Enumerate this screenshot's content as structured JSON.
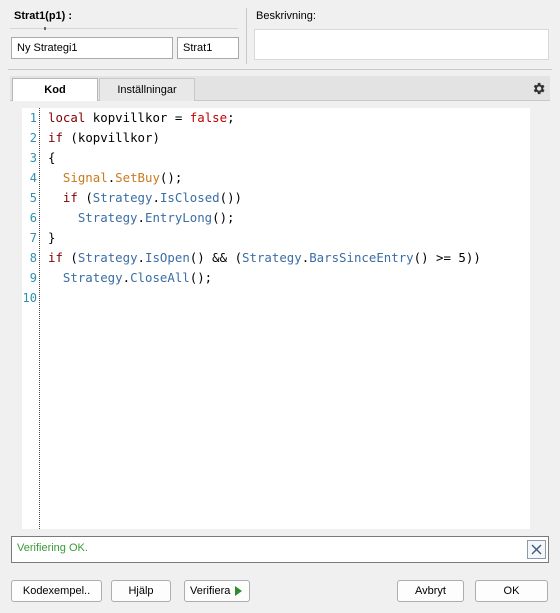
{
  "header": {
    "title": "Strat1(p1) :",
    "name_value": "Ny Strategi1",
    "short_value": "Strat1",
    "description_label": "Beskrivning:",
    "description_value": ""
  },
  "tabs": [
    {
      "label": "Kod",
      "active": true
    },
    {
      "label": "Inställningar",
      "active": false
    }
  ],
  "settings_icon": "gear-icon",
  "editor": {
    "line_numbers": [
      "1",
      "2",
      "3",
      "4",
      "5",
      "6",
      "7",
      "8",
      "9",
      "10"
    ],
    "lines": [
      "local kopvillkor = false;",
      "if (kopvillkor)",
      "{",
      "  Signal.SetBuy();",
      "  if (Strategy.IsClosed())",
      "    Strategy.EntryLong();",
      "}",
      "if (Strategy.IsOpen() && (Strategy.BarsSinceEntry() >= 5))",
      "  Strategy.CloseAll();",
      ""
    ]
  },
  "status": {
    "text": "Verifiering OK.",
    "close_icon": "close-icon",
    "color": "#3a9a3a"
  },
  "buttons": {
    "code_examples": "Kodexempel..",
    "help": "Hjälp",
    "verify": "Verifiera",
    "cancel": "Avbryt",
    "ok": "OK"
  },
  "colors": {
    "keyword": "#800000",
    "class": "#3a6ea5",
    "signal": "#c97a1c",
    "boolean": "#c00000",
    "line_number": "#2b91af"
  }
}
